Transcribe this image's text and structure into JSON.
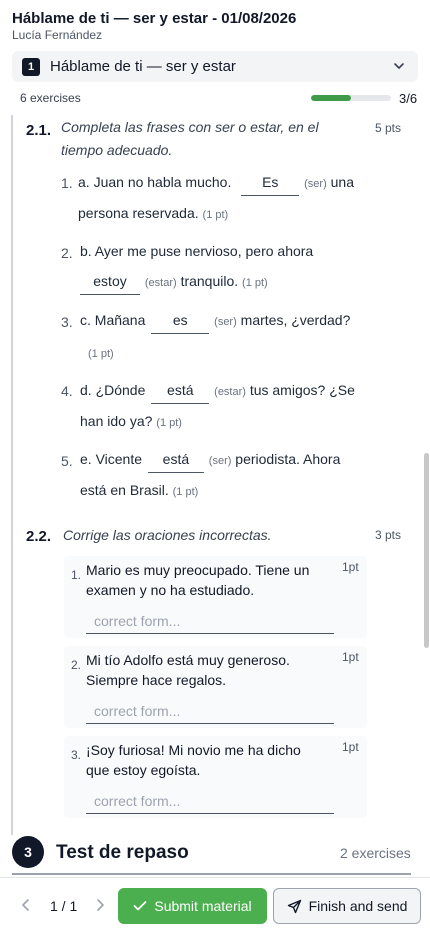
{
  "header": {
    "title": "Háblame de ti — ser y estar - 01/08/2026",
    "author": "Lucía Fernández",
    "section_number": "1",
    "section_name": "Háblame de ti — ser y estar",
    "exercise_count": "6 exercises",
    "progress_fraction": 0.5,
    "progress_text": "3/6"
  },
  "ex21": {
    "num": "2.1.",
    "instruction_l1": "Completa las frases con ser o estar, en el",
    "instruction_l2": "tiempo adecuado.",
    "points": "5 pts",
    "items": [
      {
        "n": "1.",
        "pre": "a. Juan no habla mucho.",
        "answer": "Es",
        "hint": "(ser)",
        "post": "una",
        "l2": "persona reservada.",
        "pt": "(1 pt)"
      },
      {
        "n": "2.",
        "pre": "b. Ayer me puse nervioso, pero ahora",
        "answer": "estoy",
        "hint": "(estar)",
        "post": "tranquilo.",
        "pt": "(1 pt)"
      },
      {
        "n": "3.",
        "pre": "c. Mañana",
        "answer": "es",
        "hint": "(ser)",
        "post": "martes, ¿verdad?",
        "pt": "(1 pt)"
      },
      {
        "n": "4.",
        "pre": "d. ¿Dónde",
        "answer": "está",
        "hint": "(estar)",
        "post": "tus amigos? ¿Se",
        "l2": "han ido ya?",
        "pt": "(1 pt)"
      },
      {
        "n": "5.",
        "pre": "e. Vicente",
        "answer": "está",
        "hint": "(ser)",
        "post": "periodista. Ahora",
        "l2": "está en Brasil.",
        "pt": "(1 pt)"
      }
    ]
  },
  "ex22": {
    "num": "2.2.",
    "instruction": "Corrige las oraciones incorrectas.",
    "points": "3 pts",
    "items": [
      {
        "n": "1.",
        "text": "Mario es muy preocupado. Tiene un examen y no ha estudiado.",
        "pt": "1pt",
        "placeholder": "correct form..."
      },
      {
        "n": "2.",
        "text": "Mi tío Adolfo está muy generoso. Siempre hace regalos.",
        "pt": "1pt",
        "placeholder": "correct form..."
      },
      {
        "n": "3.",
        "text": "¡Soy furiosa! Mi novio me ha dicho que estoy egoísta.",
        "pt": "1pt",
        "placeholder": "correct form..."
      }
    ]
  },
  "section3": {
    "number": "3",
    "title": "Test de repaso",
    "count": "2 exercises"
  },
  "footer": {
    "page": "1 / 1",
    "submit_label": "Submit material",
    "finish_label": "Finish and send"
  },
  "colors": {
    "accent_green": "#4bae4f",
    "progress_green": "#3f9b48",
    "dark": "#111827"
  }
}
